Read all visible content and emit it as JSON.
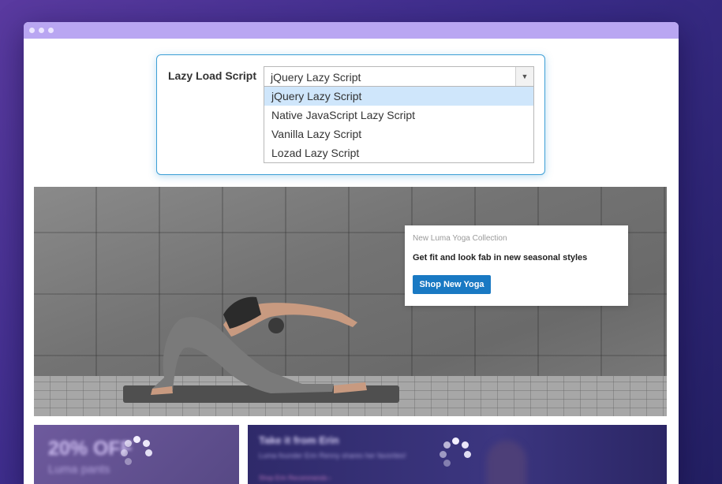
{
  "config": {
    "label": "Lazy Load Script",
    "selected_value": "jQuery Lazy Script",
    "options": [
      "jQuery Lazy Script",
      "Native JavaScript Lazy Script",
      "Vanilla Lazy Script",
      "Lozad Lazy Script"
    ]
  },
  "hero": {
    "kicker": "New Luma Yoga  Collection",
    "headline": "Get fit and look fab in new seasonal styles",
    "button_label": "Shop New Yoga",
    "button_color": "#1979c3"
  },
  "tiles": {
    "left": {
      "title": "20% OFF",
      "subtitle": "Luma pants"
    },
    "right": {
      "title": "Take it from Erin",
      "subtitle": "Luma founder Erin Renny shares her favorites!",
      "link": "Shop Erin Recommends ›"
    }
  },
  "colors": {
    "accent": "#3d9fd6",
    "titlebar": "#b9a6f2",
    "option_highlight": "#cfe6fb"
  }
}
